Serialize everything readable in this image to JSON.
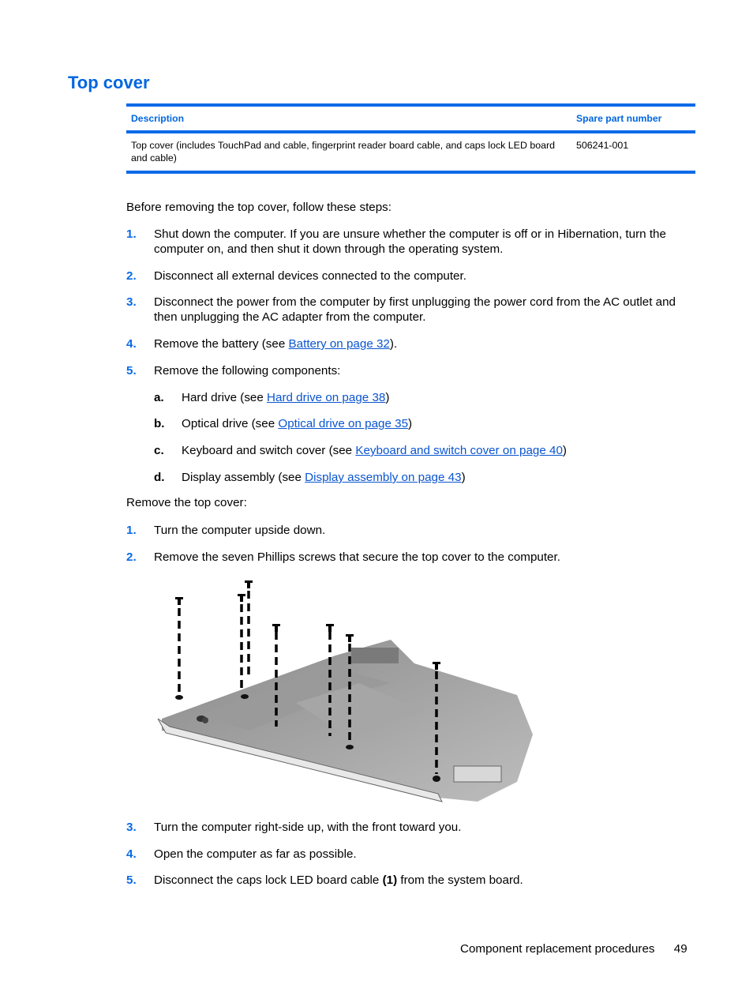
{
  "page": {
    "title": "Top cover",
    "table": {
      "headers": {
        "description": "Description",
        "spare_part": "Spare part number"
      },
      "rows": [
        {
          "description": "Top cover (includes TouchPad and cable, fingerprint reader board cable, and caps lock LED board and cable)",
          "spare_part": "506241-001"
        }
      ]
    },
    "intro_before": "Before removing the top cover, follow these steps:",
    "before_steps": [
      {
        "num": "1.",
        "text": "Shut down the computer. If you are unsure whether the computer is off or in Hibernation, turn the computer on, and then shut it down through the operating system."
      },
      {
        "num": "2.",
        "text": "Disconnect all external devices connected to the computer."
      },
      {
        "num": "3.",
        "text": "Disconnect the power from the computer by first unplugging the power cord from the AC outlet and then unplugging the AC adapter from the computer."
      },
      {
        "num": "4.",
        "pre": "Remove the battery (see ",
        "link": "Battery on page 32",
        "post": ")."
      },
      {
        "num": "5.",
        "text": "Remove the following components:"
      }
    ],
    "components": [
      {
        "letter": "a.",
        "pre": "Hard drive (see ",
        "link": "Hard drive on page 38",
        "post": ")"
      },
      {
        "letter": "b.",
        "pre": "Optical drive (see ",
        "link": "Optical drive on page 35",
        "post": ")"
      },
      {
        "letter": "c.",
        "pre": "Keyboard and switch cover (see ",
        "link": "Keyboard and switch cover on page 40",
        "post": ")"
      },
      {
        "letter": "d.",
        "pre": "Display assembly (see ",
        "link": "Display assembly on page 43",
        "post": ")"
      }
    ],
    "intro_remove": "Remove the top cover:",
    "remove_steps": [
      {
        "num": "1.",
        "text": "Turn the computer upside down."
      },
      {
        "num": "2.",
        "text": "Remove the seven Phillips screws that secure the top cover to the computer."
      },
      {
        "num": "3.",
        "text": "Turn the computer right-side up, with the front toward you."
      },
      {
        "num": "4.",
        "text": "Open the computer as far as possible."
      },
      {
        "num": "5.",
        "pre": "Disconnect the caps lock LED board cable ",
        "bold": "(1)",
        "post": " from the system board."
      }
    ],
    "figure": {
      "description": "Bottom of computer showing seven Phillips screws removed",
      "screw_count": 7
    },
    "footer": {
      "section": "Component replacement procedures",
      "page_number": "49"
    }
  }
}
